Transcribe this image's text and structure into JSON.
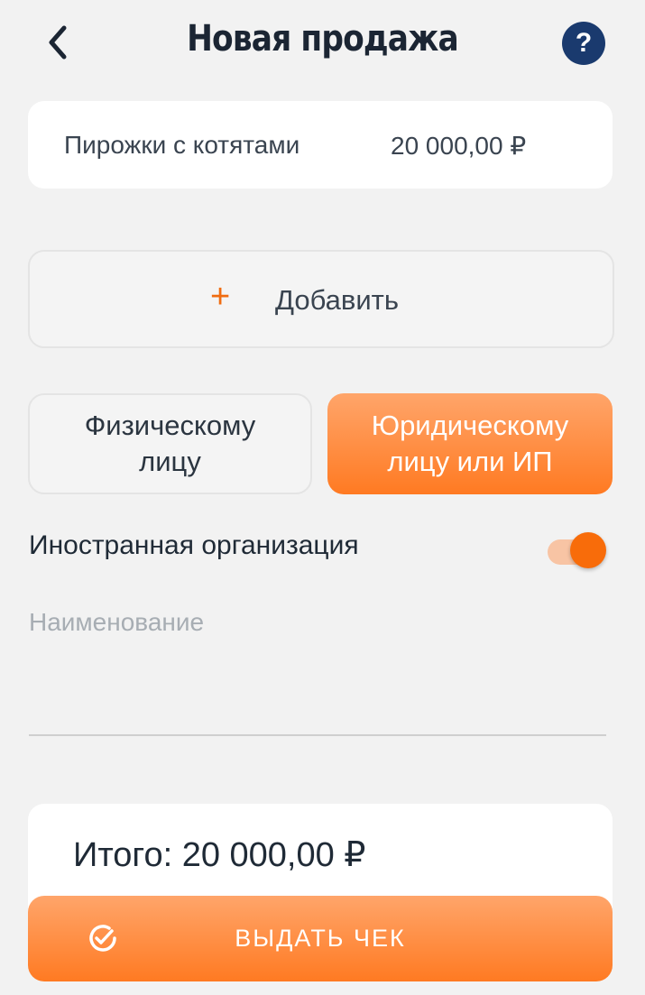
{
  "header": {
    "title": "Новая продажа",
    "back_icon": "chevron-left-icon",
    "help_label": "?"
  },
  "item": {
    "name": "Пирожки с котятами",
    "price": "20 000,00 ₽"
  },
  "add_button": {
    "plus": "+",
    "label": "Добавить"
  },
  "buyer_tabs": {
    "individual_line1": "Физическому",
    "individual_line2": "лицу",
    "legal_line1": "Юридическому",
    "legal_line2": "лицу или ИП",
    "selected": "legal"
  },
  "foreign_org": {
    "label": "Иностранная организация",
    "enabled": true
  },
  "name_field": {
    "placeholder": "Наименование",
    "value": ""
  },
  "total": {
    "label": "Итого: 20 000,00 ₽"
  },
  "issue_button": {
    "label": "ВЫДАТЬ ЧЕК",
    "icon": "check-circle-icon"
  },
  "colors": {
    "accent": "#ff7a22",
    "help_bg": "#1a3a6e",
    "background": "#f2f2f2"
  }
}
